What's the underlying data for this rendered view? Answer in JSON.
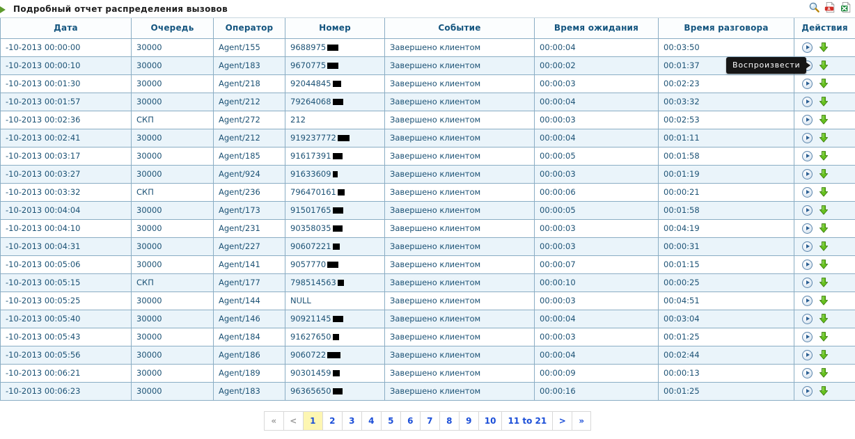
{
  "titlebar": {
    "title": "Подробный отчет распределения вызовов",
    "icons": [
      {
        "name": "search-icon",
        "label": "search"
      },
      {
        "name": "pdf-export-icon",
        "label": "pdf"
      },
      {
        "name": "excel-export-icon",
        "label": "excel"
      }
    ]
  },
  "tooltip": {
    "text": "Воспроизвести"
  },
  "table": {
    "columns": [
      "Дата",
      "Очередь",
      "Оператор",
      "Номер",
      "Событие",
      "Время ожидания",
      "Время разговора",
      "Действия"
    ],
    "rows": [
      {
        "date": "-10-2013 00:00:00",
        "queue": "30000",
        "operator": "Agent/155",
        "number": "9688975",
        "redact": 16,
        "event": "Завершено клиентом",
        "wait": "00:00:04",
        "talk": "00:03:50"
      },
      {
        "date": "-10-2013 00:00:10",
        "queue": "30000",
        "operator": "Agent/183",
        "number": "9670775",
        "redact": 16,
        "event": "Завершено клиентом",
        "wait": "00:00:02",
        "talk": "00:01:37"
      },
      {
        "date": "-10-2013 00:01:30",
        "queue": "30000",
        "operator": "Agent/218",
        "number": "92044845",
        "redact": 12,
        "event": "Завершено клиентом",
        "wait": "00:00:03",
        "talk": "00:02:23"
      },
      {
        "date": "-10-2013 00:01:57",
        "queue": "30000",
        "operator": "Agent/212",
        "number": "79264068",
        "redact": 15,
        "event": "Завершено клиентом",
        "wait": "00:00:04",
        "talk": "00:03:32"
      },
      {
        "date": "-10-2013 00:02:36",
        "queue": "СКП",
        "operator": "Agent/272",
        "number": "212",
        "redact": 0,
        "event": "Завершено клиентом",
        "wait": "00:00:03",
        "talk": "00:02:53"
      },
      {
        "date": "-10-2013 00:02:41",
        "queue": "30000",
        "operator": "Agent/212",
        "number": "919237772",
        "redact": 17,
        "event": "Завершено клиентом",
        "wait": "00:00:04",
        "talk": "00:01:11"
      },
      {
        "date": "-10-2013 00:03:17",
        "queue": "30000",
        "operator": "Agent/185",
        "number": "91617391",
        "redact": 14,
        "event": "Завершено клиентом",
        "wait": "00:00:05",
        "talk": "00:01:58"
      },
      {
        "date": "-10-2013 00:03:27",
        "queue": "30000",
        "operator": "Agent/924",
        "number": "91633609",
        "redact": 7,
        "event": "Завершено клиентом",
        "wait": "00:00:03",
        "talk": "00:01:19"
      },
      {
        "date": "-10-2013 00:03:32",
        "queue": "СКП",
        "operator": "Agent/236",
        "number": "796470161",
        "redact": 10,
        "event": "Завершено клиентом",
        "wait": "00:00:06",
        "talk": "00:00:21"
      },
      {
        "date": "-10-2013 00:04:04",
        "queue": "30000",
        "operator": "Agent/173",
        "number": "91501765",
        "redact": 15,
        "event": "Завершено клиентом",
        "wait": "00:00:05",
        "talk": "00:01:58"
      },
      {
        "date": "-10-2013 00:04:10",
        "queue": "30000",
        "operator": "Agent/231",
        "number": "90358035",
        "redact": 14,
        "event": "Завершено клиентом",
        "wait": "00:00:03",
        "talk": "00:04:19"
      },
      {
        "date": "-10-2013 00:04:31",
        "queue": "30000",
        "operator": "Agent/227",
        "number": "90607221",
        "redact": 10,
        "event": "Завершено клиентом",
        "wait": "00:00:03",
        "talk": "00:00:31"
      },
      {
        "date": "-10-2013 00:05:06",
        "queue": "30000",
        "operator": "Agent/141",
        "number": "9057770",
        "redact": 16,
        "event": "Завершено клиентом",
        "wait": "00:00:07",
        "talk": "00:01:15"
      },
      {
        "date": "-10-2013 00:05:15",
        "queue": "СКП",
        "operator": "Agent/177",
        "number": "798514563",
        "redact": 9,
        "event": "Завершено клиентом",
        "wait": "00:00:10",
        "talk": "00:00:25"
      },
      {
        "date": "-10-2013 00:05:25",
        "queue": "30000",
        "operator": "Agent/144",
        "number": "NULL",
        "redact": 0,
        "event": "Завершено клиентом",
        "wait": "00:00:03",
        "talk": "00:04:51"
      },
      {
        "date": "-10-2013 00:05:40",
        "queue": "30000",
        "operator": "Agent/146",
        "number": "90921145",
        "redact": 15,
        "event": "Завершено клиентом",
        "wait": "00:00:04",
        "talk": "00:03:04"
      },
      {
        "date": "-10-2013 00:05:43",
        "queue": "30000",
        "operator": "Agent/184",
        "number": "91627650",
        "redact": 9,
        "event": "Завершено клиентом",
        "wait": "00:00:03",
        "talk": "00:01:25"
      },
      {
        "date": "-10-2013 00:05:56",
        "queue": "30000",
        "operator": "Agent/186",
        "number": "9060722",
        "redact": 19,
        "event": "Завершено клиентом",
        "wait": "00:00:04",
        "talk": "00:02:44"
      },
      {
        "date": "-10-2013 00:06:21",
        "queue": "30000",
        "operator": "Agent/189",
        "number": "90301459",
        "redact": 10,
        "event": "Завершено клиентом",
        "wait": "00:00:09",
        "talk": "00:00:13"
      },
      {
        "date": "-10-2013 00:06:23",
        "queue": "30000",
        "operator": "Agent/183",
        "number": "96365650",
        "redact": 14,
        "event": "Завершено клиентом",
        "wait": "00:00:16",
        "talk": "00:01:25"
      }
    ],
    "row_actions": {
      "play": "Воспроизвести",
      "download": "Скачать"
    }
  },
  "pagination": {
    "items": [
      {
        "label": "«",
        "state": "muted"
      },
      {
        "label": "<",
        "state": "muted"
      },
      {
        "label": "1",
        "state": "active"
      },
      {
        "label": "2",
        "state": "normal"
      },
      {
        "label": "3",
        "state": "normal"
      },
      {
        "label": "4",
        "state": "normal"
      },
      {
        "label": "5",
        "state": "normal"
      },
      {
        "label": "6",
        "state": "normal"
      },
      {
        "label": "7",
        "state": "normal"
      },
      {
        "label": "8",
        "state": "normal"
      },
      {
        "label": "9",
        "state": "normal"
      },
      {
        "label": "10",
        "state": "normal"
      },
      {
        "label": "11 to 21",
        "state": "normal"
      },
      {
        "label": ">",
        "state": "normal"
      },
      {
        "label": "»",
        "state": "normal"
      }
    ]
  },
  "colors": {
    "header_text": "#14557f",
    "date_text": "#ed7d20",
    "event_text": "#7ba428",
    "cell_text": "#1c5275",
    "row_alt_bg": "#eaf4fa",
    "border": "#8aadc4",
    "pager_link": "#1c4fd8",
    "pager_active_bg": "#fdf6b2",
    "tooltip_bg": "#161616"
  }
}
